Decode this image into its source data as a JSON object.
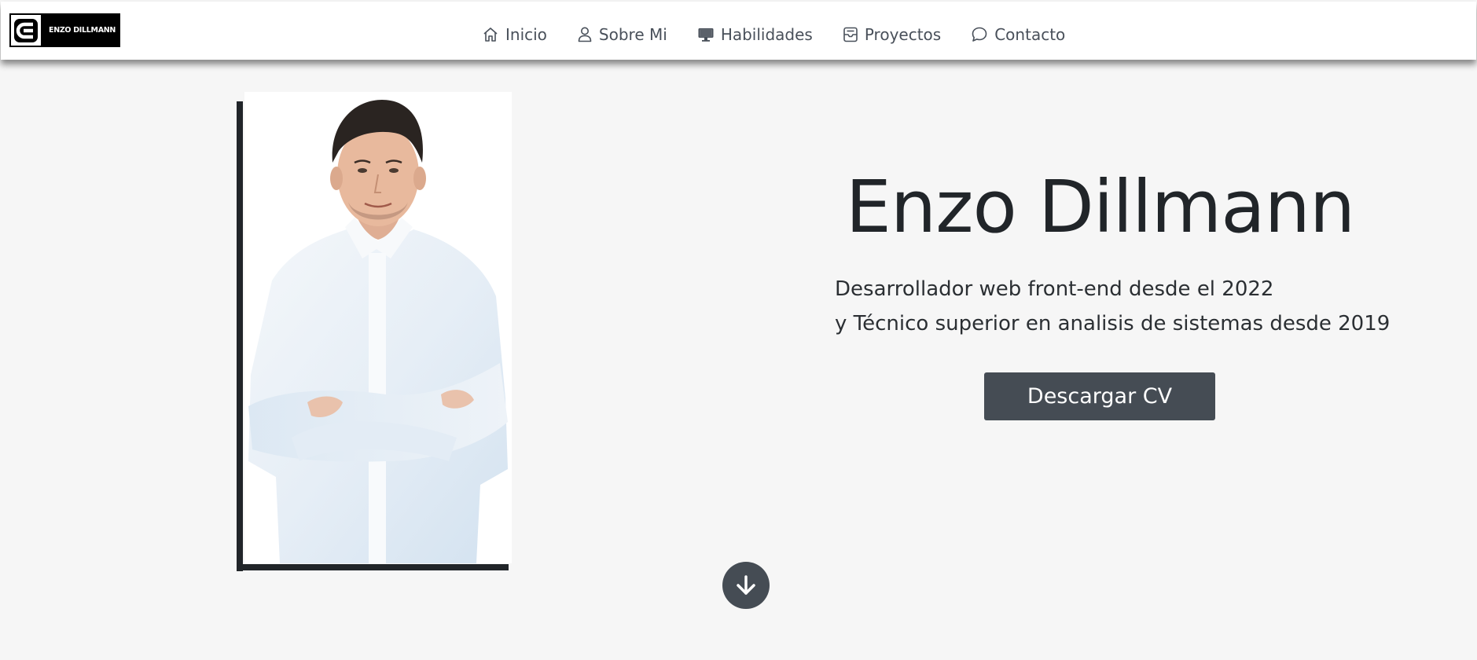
{
  "brand": {
    "text": "ENZO DILLMANN",
    "logo_icon": "enzo-e-logo-icon"
  },
  "nav": {
    "items": [
      {
        "label": "Inicio",
        "icon": "home-icon"
      },
      {
        "label": "Sobre Mi",
        "icon": "person-icon"
      },
      {
        "label": "Habilidades",
        "icon": "monitor-icon"
      },
      {
        "label": "Proyectos",
        "icon": "inbox-icon"
      },
      {
        "label": "Contacto",
        "icon": "chat-bubble-icon"
      }
    ]
  },
  "hero": {
    "name": "Enzo Dillmann",
    "line1": "Desarrollador web front-end desde el 2022",
    "line2": "y Técnico superior en analisis de sistemas desde 2019",
    "cv_button": "Descargar CV",
    "scroll_icon": "arrow-down-icon"
  },
  "colors": {
    "background": "#f6f6f6",
    "text": "#212529",
    "button": "#454c54",
    "frame": "#212529"
  }
}
